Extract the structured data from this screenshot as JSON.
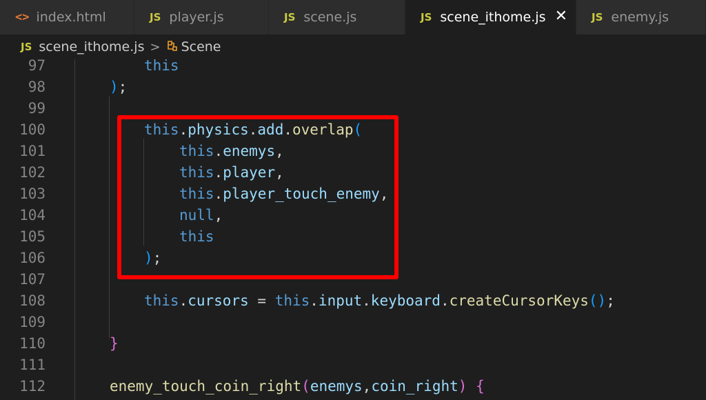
{
  "tabs": [
    {
      "label": "index.html",
      "badge": "<>",
      "kind": "html",
      "active": false
    },
    {
      "label": "player.js",
      "badge": "JS",
      "kind": "js",
      "active": false
    },
    {
      "label": "scene.js",
      "badge": "JS",
      "kind": "js",
      "active": false
    },
    {
      "label": "scene_ithome.js",
      "badge": "JS",
      "kind": "js",
      "active": true,
      "close": "✕"
    },
    {
      "label": "enemy.js",
      "badge": "JS",
      "kind": "js",
      "active": false
    }
  ],
  "breadcrumb": {
    "badge": "JS",
    "file": "scene_ithome.js",
    "separator": ">",
    "symbol": "Scene"
  },
  "line_numbers": [
    "97",
    "98",
    "99",
    "100",
    "101",
    "102",
    "103",
    "104",
    "105",
    "106",
    "107",
    "108",
    "109",
    "110",
    "111",
    "112"
  ],
  "code": {
    "l97": [
      "this"
    ],
    "l98": [
      ")",
      ";"
    ],
    "l100": [
      "this",
      ".",
      "physics",
      ".",
      "add",
      ".",
      "overlap",
      "("
    ],
    "l101": [
      "this",
      ".",
      "enemys",
      ","
    ],
    "l102": [
      "this",
      ".",
      "player",
      ","
    ],
    "l103": [
      "this",
      ".",
      "player_touch_enemy",
      ","
    ],
    "l104": [
      "null",
      ","
    ],
    "l105": [
      "this"
    ],
    "l106": [
      ")",
      ";"
    ],
    "l108": [
      "this",
      ".",
      "cursors",
      " = ",
      "this",
      ".",
      "input",
      ".",
      "keyboard",
      ".",
      "createCursorKeys",
      "()",
      ";"
    ],
    "l110": [
      "}"
    ],
    "l112": [
      "enemy_touch_coin_right",
      "(",
      "enemys",
      ",",
      "coin_right",
      ")",
      " ",
      "{"
    ]
  },
  "colors": {
    "background": "#1e1e1e",
    "highlight_border": "#ff0000",
    "keyword": "#569cd6",
    "property": "#9cdcfe",
    "function": "#dcdcaa"
  }
}
